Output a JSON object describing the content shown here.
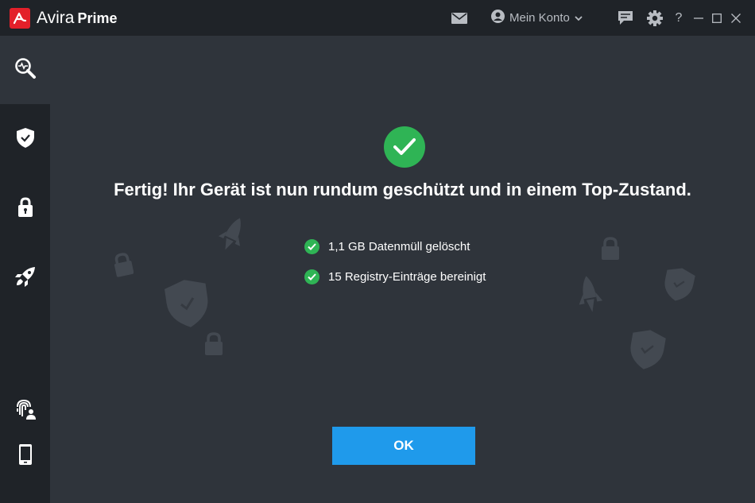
{
  "app": {
    "brand_name": "Avira",
    "brand_product": "Prime",
    "logo_icon": "avira-logo-icon",
    "accent_color": "#e3202a"
  },
  "titlebar": {
    "mail_icon": "mail-icon",
    "account_label": "Mein Konto",
    "account_icon": "user-circle-icon",
    "feedback_icon": "feedback-icon",
    "settings_icon": "gear-icon",
    "help_label": "?",
    "minimize_icon": "minimize-icon",
    "maximize_icon": "maximize-icon",
    "close_icon": "close-icon"
  },
  "sidebar": {
    "items": [
      {
        "icon": "scan-icon",
        "active": true
      },
      {
        "icon": "shield-check-icon",
        "active": false
      },
      {
        "icon": "lock-icon",
        "active": false
      },
      {
        "icon": "rocket-icon",
        "active": false
      },
      {
        "icon": "fingerprint-user-icon",
        "active": false
      },
      {
        "icon": "smartphone-icon",
        "active": false
      }
    ]
  },
  "main": {
    "status_icon": "check-circle-icon",
    "status_color": "#2fb455",
    "headline": "Fertig! Ihr Gerät ist nun rundum geschützt und in einem Top-Zustand.",
    "results": [
      {
        "text": "1,1 GB Datenmüll gelöscht"
      },
      {
        "text": "15 Registry-Einträge bereinigt"
      }
    ],
    "ok_label": "OK",
    "ok_color": "#1f9aeb"
  }
}
